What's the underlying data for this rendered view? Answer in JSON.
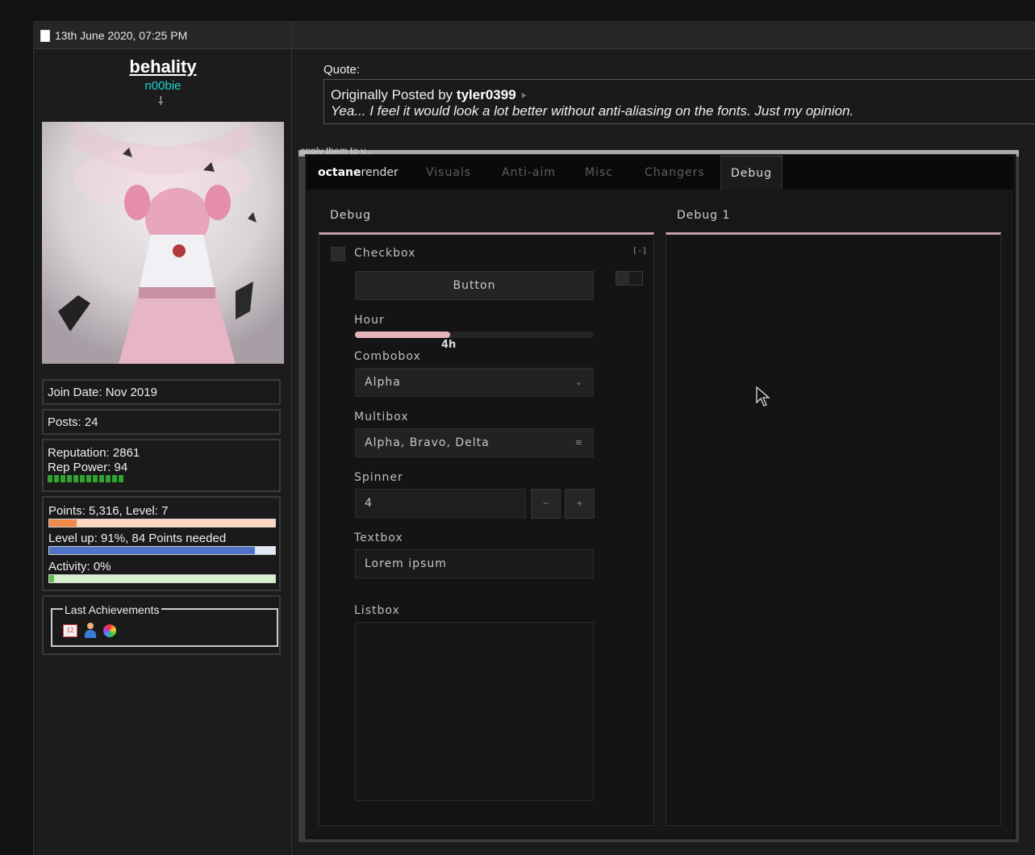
{
  "post": {
    "date": "13th June 2020, 07:25 PM",
    "username": "behality",
    "user_title": "n00bie",
    "join_date": "Join Date: Nov 2019",
    "posts": "Posts: 24",
    "reputation": "Reputation: 2861",
    "rep_power": "Rep Power: 94",
    "points": "Points: 5,316, Level: 7",
    "points_progress": 0.12,
    "level_up": "Level up: 91%, 84 Points needed",
    "level_up_progress": 0.91,
    "activity": "Activity: 0%",
    "activity_progress": 0.02,
    "achievements_title": "Last Achievements"
  },
  "quote": {
    "label": "Quote:",
    "prefix": "Originally Posted by",
    "author": "tyler0399",
    "text": "Yea... I feel it would look a lot better without anti-aliasing on the fonts. Just my opinion."
  },
  "embed": {
    "caption": "apply them to v..."
  },
  "menu": {
    "brand_bold": "octane",
    "brand_rest": "render",
    "tabs": [
      "Visuals",
      "Anti-aim",
      "Misc",
      "Changers",
      "Debug"
    ],
    "active_tab": "Debug",
    "group_left": "Debug",
    "group_right": "Debug 1",
    "checkbox_label": "Checkbox",
    "button_label": "Button",
    "hour_label": "Hour",
    "hour_value": "4h",
    "hour_fraction": 0.4,
    "combobox_label": "Combobox",
    "combobox_value": "Alpha",
    "multibox_label": "Multibox",
    "multibox_value": "Alpha, Bravo, Delta",
    "spinner_label": "Spinner",
    "spinner_value": "4",
    "spinner_minus": "−",
    "spinner_plus": "+",
    "textbox_label": "Textbox",
    "textbox_value": "Lorem ipsum",
    "listbox_label": "Listbox",
    "keybind_label": "[-]"
  },
  "colors": {
    "accent": "#e8b4bc",
    "username_title": "#19d3d3"
  }
}
